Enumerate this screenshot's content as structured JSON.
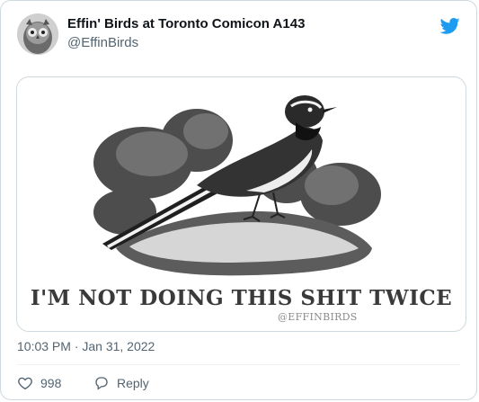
{
  "tweet": {
    "author_name": "Effin' Birds at Toronto Comicon A143",
    "author_handle": "@EffinBirds",
    "timestamp": "10:03 PM · Jan 31, 2022"
  },
  "media": {
    "caption": "I'M NOT DOING THIS SHIT TWICE",
    "watermark": "@EFFINBIRDS"
  },
  "actions": {
    "like_count": "998",
    "reply_label": "Reply"
  },
  "colors": {
    "brand": "#1d9bf0",
    "secondary_text": "#536471",
    "border": "#cfd9de"
  },
  "icons": [
    "owl-avatar",
    "twitter-bird-icon",
    "heart-icon",
    "reply-icon"
  ]
}
